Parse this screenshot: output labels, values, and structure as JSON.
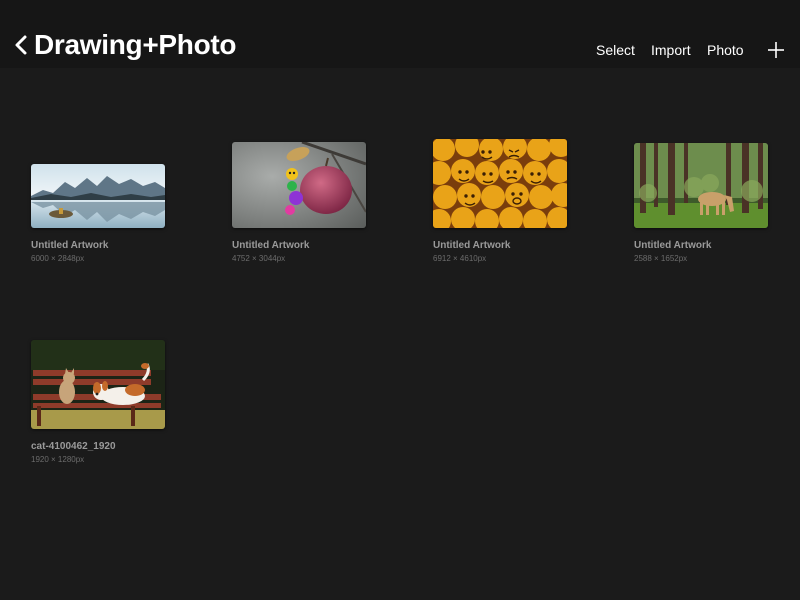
{
  "header": {
    "title": "Drawing+Photo",
    "select_label": "Select",
    "import_label": "Import",
    "photo_label": "Photo",
    "back_icon": "chevron-left-icon",
    "add_icon": "plus-icon"
  },
  "gallery": {
    "items": [
      {
        "title": "Untitled Artwork",
        "size": "6000 × 2848px"
      },
      {
        "title": "Untitled Artwork",
        "size": "4752 × 3044px"
      },
      {
        "title": "Untitled Artwork",
        "size": "6912 × 4610px"
      },
      {
        "title": "Untitled Artwork",
        "size": "2588 × 1652px"
      },
      {
        "title": "cat-4100462_1920",
        "size": "1920 × 1280px"
      }
    ]
  },
  "colors": {
    "background": "#1b1b1b",
    "topbar": "#161616",
    "text": "#ffffff",
    "caption": "#9a9a9a",
    "subcaption": "#6c6c6c"
  }
}
